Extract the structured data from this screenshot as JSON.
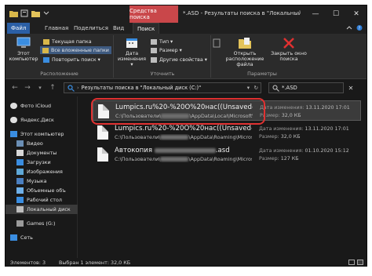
{
  "titlebar": {
    "context_tab": "Средства поиска",
    "window_title": "*.ASD - Результаты поиска в \"Локальный диск (C:...",
    "minimize": "—",
    "maximize": "☐",
    "close": "✕"
  },
  "ribbon_tabs": {
    "file": "Файл",
    "home": "Главная",
    "share": "Поделиться",
    "view": "Вид",
    "search": "Поиск"
  },
  "ribbon": {
    "this_pc": "Этот компьютер",
    "current_folder": "Текущая папка",
    "all_subfolders": "Все вложенные папки",
    "search_again": "Повторить поиск ▾",
    "group_location": "Расположение",
    "date_modified": "Дата изменения ▾",
    "type": "Тип ▾",
    "size": "Размер ▾",
    "other_props": "Другие свойства ▾",
    "group_refine": "Уточнить",
    "recent_searches": "",
    "open_location": "Открыть расположение файла",
    "close_search": "Закрыть окно поиска",
    "group_options": "Параметры"
  },
  "address": {
    "path": "Результаты поиска в \"Локальный диск (C:)\"",
    "search_value": "*.ASD"
  },
  "sidebar": {
    "items": [
      {
        "label": "Фото iCloud"
      },
      {
        "label": "Яндекс.Диск"
      },
      {
        "label": "Этот компьютер"
      },
      {
        "label": "Видео"
      },
      {
        "label": "Документы"
      },
      {
        "label": "Загрузки"
      },
      {
        "label": "Изображения"
      },
      {
        "label": "Музыка"
      },
      {
        "label": "Объемные объ"
      },
      {
        "label": "Рабочий стол"
      },
      {
        "label": "Локальный диск"
      },
      {
        "label": "Games (G:)"
      },
      {
        "label": "Сеть"
      }
    ]
  },
  "files": [
    {
      "name": "Lumpics.ru%20-%20O%20нас((Unsaved-308495...",
      "path_start": "C:\\Пользователи\\",
      "path_end": "\\AppData\\Local\\Microsoft\\Office\\...",
      "date_label": "Дата изменения:",
      "date": "13.11.2020 17:01",
      "size_label": "Размер:",
      "size": "32,0 КБ"
    },
    {
      "name": "Lumpics.ru%20-%20O%20нас((Unsaved-308495...",
      "path_start": "C:\\Пользователи\\",
      "path_end": "\\AppData\\Roaming\\Microsoft\\Wo...",
      "date_label": "Дата изменения:",
      "date": "13.11.2020 17:01",
      "size_label": "Размер:",
      "size": "32,0 КБ"
    },
    {
      "name_start": "Автокопия",
      "name_end": ".asd",
      "path_start": "C:\\Пользователи\\",
      "path_end": "\\AppData\\Roaming\\Microsoft\\Word",
      "date_label": "Дата изменения:",
      "date": "01.10.2020 15:12",
      "size_label": "Размер:",
      "size": "127 КБ"
    }
  ],
  "status": {
    "count": "Элементов: 3",
    "selected": "Выбран 1 элемент: 32,0 КБ"
  },
  "colors": {
    "accent_file_tab": "#2b5fa5",
    "context_tab": "#c9474a",
    "highlight": "#e03131",
    "background": "#191919"
  }
}
